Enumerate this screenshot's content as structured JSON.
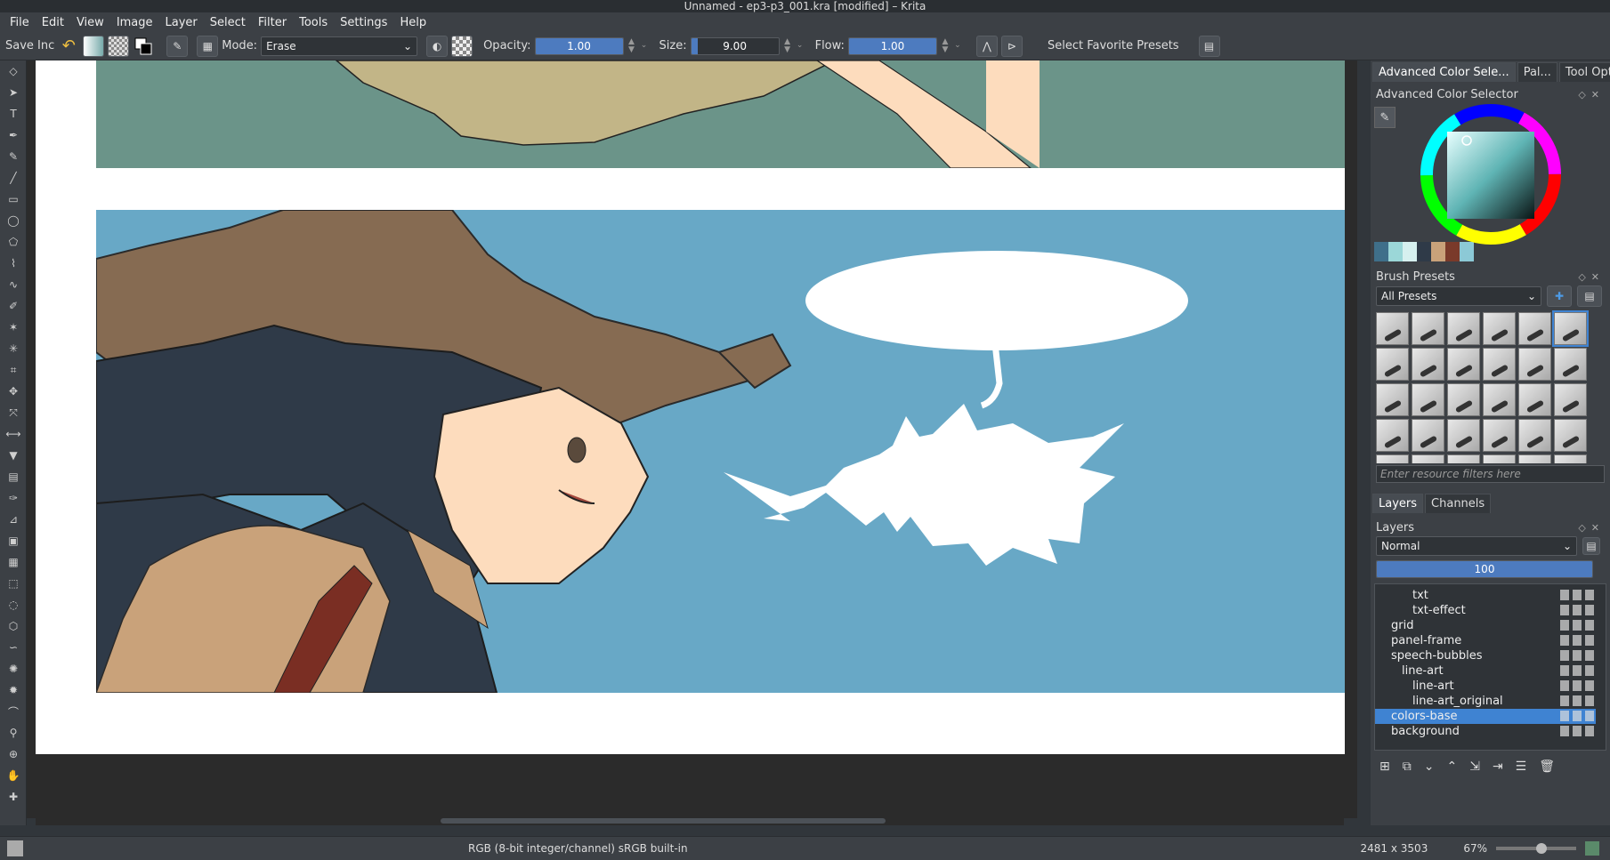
{
  "window": {
    "title": "Unnamed - ep3-p3_001.kra [modified] – Krita"
  },
  "menu": [
    "File",
    "Edit",
    "View",
    "Image",
    "Layer",
    "Select",
    "Filter",
    "Tools",
    "Settings",
    "Help"
  ],
  "toolbar": {
    "save_inc": "Save Inc",
    "mode_label": "Mode:",
    "mode_value": "Erase",
    "opacity_label": "Opacity:",
    "opacity_value": "1.00",
    "opacity_fraction": 1.0,
    "size_label": "Size:",
    "size_value": "9.00",
    "flow_label": "Flow:",
    "flow_value": "1.00",
    "presets_label": "Select Favorite Presets"
  },
  "dock": {
    "tabs": [
      "Advanced Color Sele...",
      "Pal...",
      "Tool Opti..."
    ],
    "color_selector_title": "Advanced Color Selector",
    "swatches": [
      "#3f6f8a",
      "#9bd7d8",
      "#d6f0ef",
      "#2f3a48",
      "#c9a27a",
      "#7a3a2a",
      "#8cc9d6"
    ],
    "brush_presets_title": "Brush Presets",
    "presets_filter": "All Presets",
    "resource_filter_placeholder": "Enter resource filters here",
    "layer_tabs": [
      "Layers",
      "Channels"
    ],
    "layers_title": "Layers",
    "blend_mode": "Normal",
    "layer_opacity": "100",
    "layers": [
      {
        "name": "txt",
        "indent": 3
      },
      {
        "name": "txt-effect",
        "indent": 3
      },
      {
        "name": "grid",
        "indent": 1
      },
      {
        "name": "panel-frame",
        "indent": 1
      },
      {
        "name": "speech-bubbles",
        "indent": 1
      },
      {
        "name": "line-art",
        "indent": 2
      },
      {
        "name": "line-art",
        "indent": 3
      },
      {
        "name": "line-art_original",
        "indent": 3
      },
      {
        "name": "colors-base",
        "indent": 1,
        "selected": true
      },
      {
        "name": "background",
        "indent": 1
      }
    ]
  },
  "status": {
    "color_info": "RGB (8-bit integer/channel)  sRGB built-in",
    "dimensions": "2481 x 3503",
    "zoom": "67%"
  },
  "colors": {
    "accent": "#3f83d2",
    "panel_sky": "#68a8c6",
    "panel_top": "#6b9489"
  }
}
